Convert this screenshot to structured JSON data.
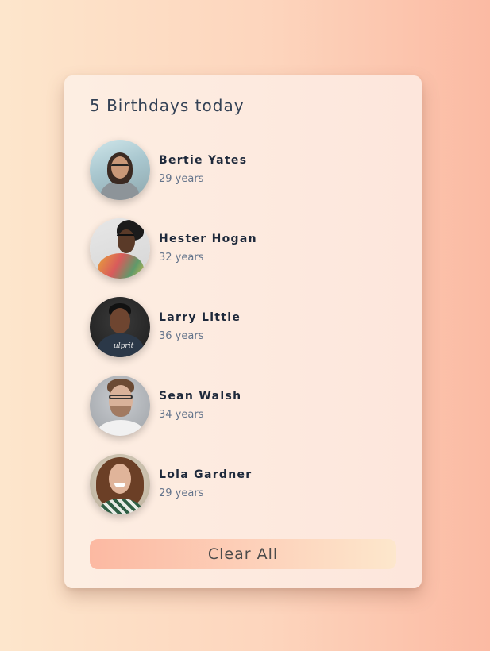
{
  "card": {
    "title": "5 Birthdays today",
    "people": [
      {
        "name": "Bertie Yates",
        "age": "29 years"
      },
      {
        "name": "Hester Hogan",
        "age": "32 years"
      },
      {
        "name": "Larry Little",
        "age": "36 years"
      },
      {
        "name": "Sean Walsh",
        "age": "34 years"
      },
      {
        "name": "Lola Gardner",
        "age": "29 years"
      }
    ],
    "clear_button_label": "Clear All"
  },
  "colors": {
    "background_left": "#fde6cc",
    "background_right": "#fbbaa3",
    "title_text": "#334155",
    "name_text": "#1e293b",
    "age_text": "#64748b"
  }
}
